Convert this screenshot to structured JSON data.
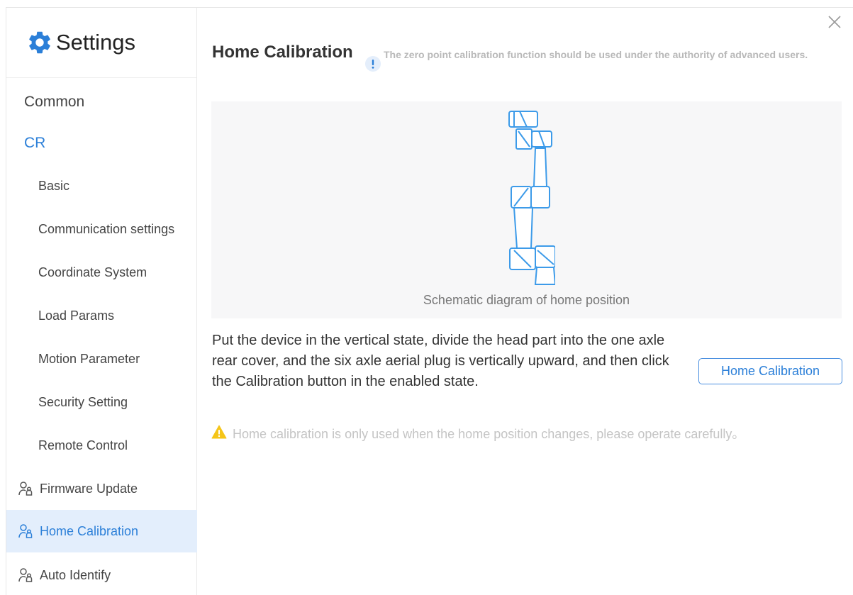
{
  "sidebar": {
    "title": "Settings",
    "items": [
      {
        "label": "Common"
      },
      {
        "label": "CR"
      },
      {
        "label": "Basic"
      },
      {
        "label": "Communication settings"
      },
      {
        "label": "Coordinate System"
      },
      {
        "label": "Load Params"
      },
      {
        "label": "Motion Parameter"
      },
      {
        "label": "Security Setting"
      },
      {
        "label": "Remote Control"
      },
      {
        "label": "Firmware Update",
        "icon": "user-group-icon"
      },
      {
        "label": "Home Calibration",
        "icon": "user-group-icon",
        "active": true
      },
      {
        "label": "Auto Identify",
        "icon": "user-group-icon"
      }
    ]
  },
  "main": {
    "title": "Home Calibration",
    "info_note": "The zero point calibration function should be used under the authority of advanced users.",
    "diagram_caption": "Schematic diagram of home position",
    "instructions": "Put the device in the vertical state, divide the head part into the one axle rear cover, and the six axle aerial plug is vertically upward, and then click the Calibration button in the enabled state.",
    "button_label": "Home Calibration",
    "warning": "Home calibration is only used when the home position changes, please operate carefully。"
  },
  "colors": {
    "accent": "#2b7fd8",
    "active_bg": "#e3eefc",
    "warning": "#f5c518",
    "robot_line": "#3d9be9"
  }
}
